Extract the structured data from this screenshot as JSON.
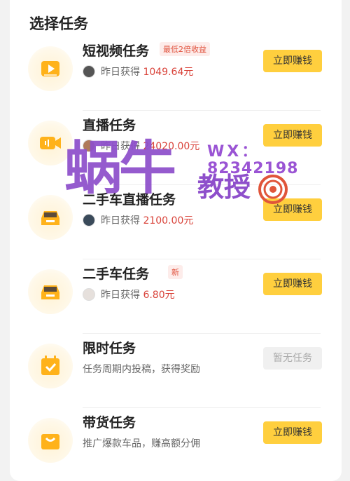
{
  "page": {
    "title": "选择任务"
  },
  "tasks": [
    {
      "name": "短视频任务",
      "tag": "最低2倍收益",
      "sub_prefix": "昨日获得",
      "amount": "1049.64元",
      "button": "立即赚钱",
      "icon": "video-play-icon"
    },
    {
      "name": "直播任务",
      "tag": "",
      "sub_prefix": "昨日获得",
      "amount": "24020.00元",
      "button": "立即赚钱",
      "icon": "camera-icon"
    },
    {
      "name": "二手车直播任务",
      "tag": "",
      "sub_prefix": "昨日获得",
      "amount": "2100.00元",
      "button": "立即赚钱",
      "icon": "car-icon"
    },
    {
      "name": "二手车任务",
      "tag": "新",
      "sub_prefix": "昨日获得",
      "amount": "6.80元",
      "button": "立即赚钱",
      "icon": "car-icon"
    },
    {
      "name": "限时任务",
      "tag": "",
      "description": "任务周期内投稿，获得奖励",
      "button": "暂无任务",
      "icon": "calendar-check-icon"
    },
    {
      "name": "带货任务",
      "tag": "",
      "description": "推广爆款车品，赚高额分佣",
      "button": "立即赚钱",
      "icon": "shopping-bag-icon"
    }
  ],
  "watermark": {
    "big": "蜗牛",
    "mid": "教授",
    "wx": "WX：",
    "number": "82342198"
  },
  "colors": {
    "accent": "#ffcf3e",
    "amount": "#d9433a",
    "icon": "#ffb21a",
    "watermark": "#8e4fcb"
  }
}
